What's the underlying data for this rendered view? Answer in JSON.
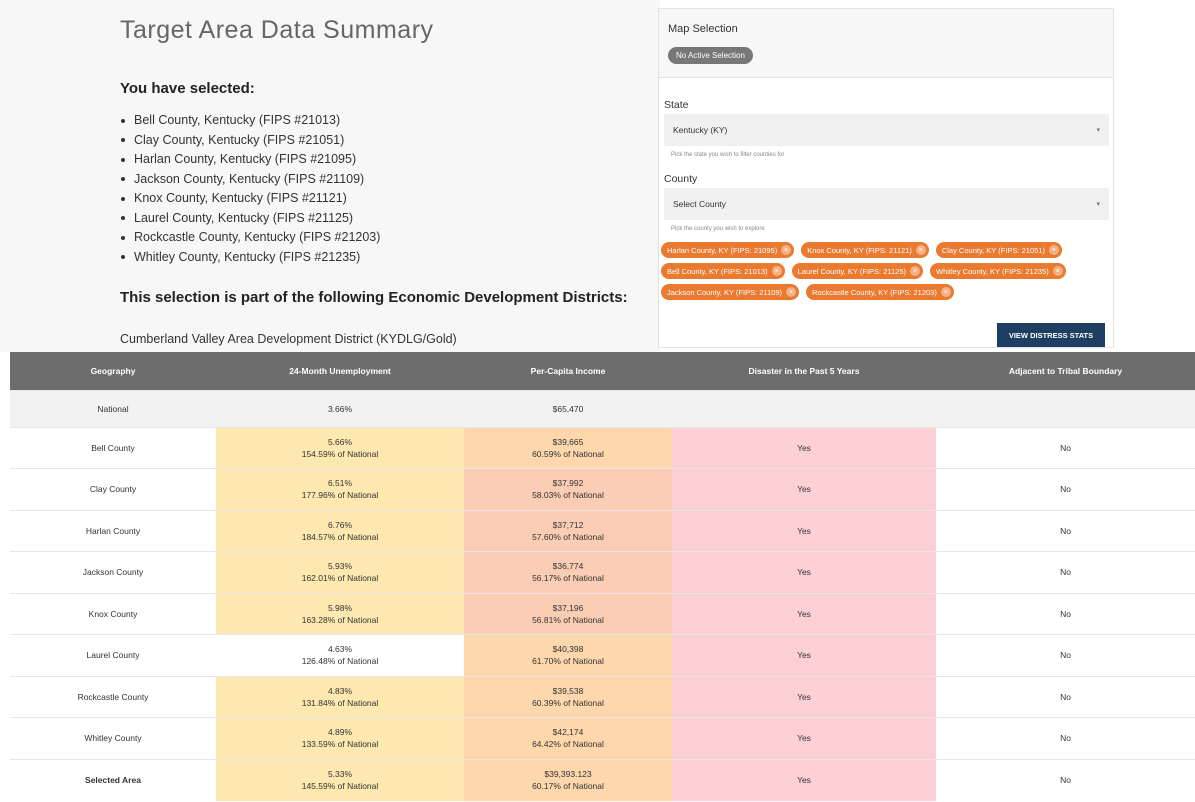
{
  "summary": {
    "title": "Target Area Data Summary",
    "selected_heading": "You have selected:",
    "counties": [
      "Bell County, Kentucky (FIPS #21013)",
      "Clay County, Kentucky (FIPS #21051)",
      "Harlan County, Kentucky (FIPS #21095)",
      "Jackson County, Kentucky (FIPS #21109)",
      "Knox County, Kentucky (FIPS #21121)",
      "Laurel County, Kentucky (FIPS #21125)",
      "Rockcastle County, Kentucky (FIPS #21203)",
      "Whitley County, Kentucky (FIPS #21235)"
    ],
    "edd_heading": "This selection is part of the following Economic Development Districts:",
    "edd_item": "Cumberland Valley Area Development District (KYDLG/Gold)",
    "edge_mark": ")"
  },
  "map_panel": {
    "title": "Map Selection",
    "no_selection": "No Active Selection",
    "state_label": "State",
    "state_value": "Kentucky (KY)",
    "state_helper": "Pick the state you wish to filter counties for",
    "county_label": "County",
    "county_placeholder": "Select County",
    "county_helper": "Pick the county you wish to explore",
    "chip_rows": [
      [
        "Harlan County, KY (FIPS: 21095)",
        "Knox County, KY (FIPS: 21121)",
        "Clay County, KY (FIPS: 21051)"
      ],
      [
        "Bell County, KY (FIPS: 21013)",
        "Laurel County, KY (FIPS: 21125)",
        "Whitley County, KY (FIPS: 21235)"
      ],
      [
        "Jackson County, KY (FIPS: 21109)",
        "Rockcastle County, KY (FIPS: 21203)"
      ]
    ],
    "caret_glyph": "▾",
    "chip_remove_glyph": "×",
    "view_button": "VIEW DISTRESS STATS"
  },
  "table": {
    "headers": [
      "Geography",
      "24-Month Unemployment",
      "Per-Capita Income",
      "Disaster in the Past 5 Years",
      "Adjacent to Tribal Boundary"
    ],
    "national": {
      "geo": "National",
      "unemployment": "3.66%",
      "income": "$65,470",
      "disaster": "",
      "tribal": ""
    },
    "rows": [
      {
        "geo": "Bell County",
        "unemp": "5.66%",
        "unemp_pct": "154.59% of National",
        "income": "$39,665",
        "income_pct": "60.59% of National",
        "disaster": "Yes",
        "tribal": "No",
        "unemp_color": "yellow",
        "income_color": "orange"
      },
      {
        "geo": "Clay County",
        "unemp": "6.51%",
        "unemp_pct": "177.96% of National",
        "income": "$37,992",
        "income_pct": "58.03% of National",
        "disaster": "Yes",
        "tribal": "No",
        "unemp_color": "yellow",
        "income_color": "salmon"
      },
      {
        "geo": "Harlan County",
        "unemp": "6.76%",
        "unemp_pct": "184.57% of National",
        "income": "$37,712",
        "income_pct": "57.60% of National",
        "disaster": "Yes",
        "tribal": "No",
        "unemp_color": "yellow",
        "income_color": "salmon"
      },
      {
        "geo": "Jackson County",
        "unemp": "5.93%",
        "unemp_pct": "162.01% of National",
        "income": "$36,774",
        "income_pct": "56.17% of National",
        "disaster": "Yes",
        "tribal": "No",
        "unemp_color": "yellow",
        "income_color": "salmon"
      },
      {
        "geo": "Knox County",
        "unemp": "5.98%",
        "unemp_pct": "163.28% of National",
        "income": "$37,196",
        "income_pct": "56.81% of National",
        "disaster": "Yes",
        "tribal": "No",
        "unemp_color": "yellow",
        "income_color": "salmon"
      },
      {
        "geo": "Laurel County",
        "unemp": "4.63%",
        "unemp_pct": "126.48% of National",
        "income": "$40,398",
        "income_pct": "61.70% of National",
        "disaster": "Yes",
        "tribal": "No",
        "unemp_color": "white",
        "income_color": "orange"
      },
      {
        "geo": "Rockcastle County",
        "unemp": "4.83%",
        "unemp_pct": "131.84% of National",
        "income": "$39,538",
        "income_pct": "60.39% of National",
        "disaster": "Yes",
        "tribal": "No",
        "unemp_color": "yellow",
        "income_color": "orange"
      },
      {
        "geo": "Whitley County",
        "unemp": "4.89%",
        "unemp_pct": "133.59% of National",
        "income": "$42,174",
        "income_pct": "64.42% of National",
        "disaster": "Yes",
        "tribal": "No",
        "unemp_color": "yellow",
        "income_color": "orange"
      },
      {
        "geo": "Selected Area",
        "unemp": "5.33%",
        "unemp_pct": "145.59% of National",
        "income": "$39,393.123",
        "income_pct": "60.17% of National",
        "disaster": "Yes",
        "tribal": "No",
        "unemp_color": "yellow",
        "income_color": "orange",
        "selected": true
      }
    ]
  },
  "colors": {
    "header_bg": "#6d6d6d",
    "chip_orange": "#ea7a30",
    "button_navy": "#1f3f62",
    "unemployment_highlight": "#fde8b0",
    "income_light": "#fed7ad",
    "income_dark": "#fccdb5",
    "disaster_red": "#fdd0d6"
  }
}
